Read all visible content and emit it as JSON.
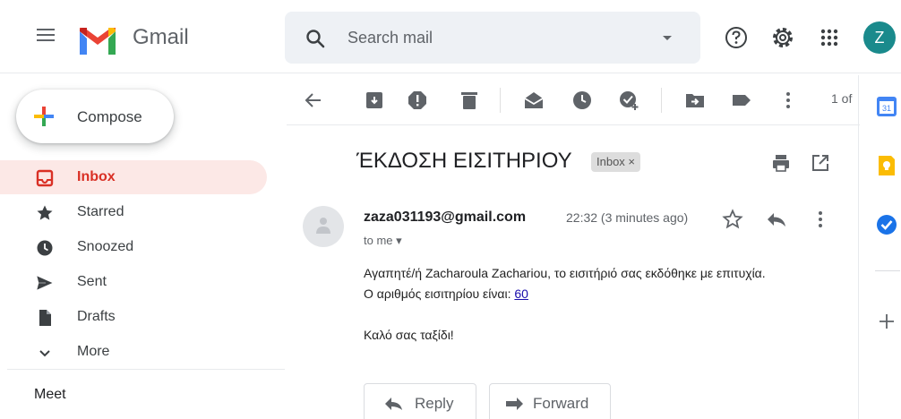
{
  "header": {
    "app_name": "Gmail",
    "search_placeholder": "Search mail",
    "avatar_initial": "Z"
  },
  "sidebar": {
    "compose_label": "Compose",
    "items": [
      {
        "label": "Inbox",
        "icon": "inbox-icon",
        "active": true
      },
      {
        "label": "Starred",
        "icon": "star-icon"
      },
      {
        "label": "Snoozed",
        "icon": "clock-icon"
      },
      {
        "label": "Sent",
        "icon": "send-icon"
      },
      {
        "label": "Drafts",
        "icon": "draft-icon"
      },
      {
        "label": "More",
        "icon": "chevron-down-icon"
      }
    ],
    "meet_label": "Meet"
  },
  "toolbar": {
    "pager": "1 of"
  },
  "message": {
    "subject": "ΈΚΔΟΣΗ ΕΙΣΙΤΗΡΙΟΥ",
    "label_chip": "Inbox ×",
    "sender": "zaza031193@gmail.com",
    "time": "22:32 (3 minutes ago)",
    "to": "to me ▾",
    "body_line1": "Αγαπητέ/ή Zacharoula Zachariou, το εισιτήριό σας εκδόθηκε με επιτυχία.",
    "body_line2_prefix": "Ο αριθμός εισιτηρίου είναι: ",
    "ticket_number": "60",
    "body_line3": "Καλό σας ταξίδι!"
  },
  "actions": {
    "reply_label": "Reply",
    "forward_label": "Forward"
  },
  "colors": {
    "accent_red": "#d93025",
    "active_bg": "#fce8e6",
    "avatar_teal": "#1a8a8c"
  }
}
